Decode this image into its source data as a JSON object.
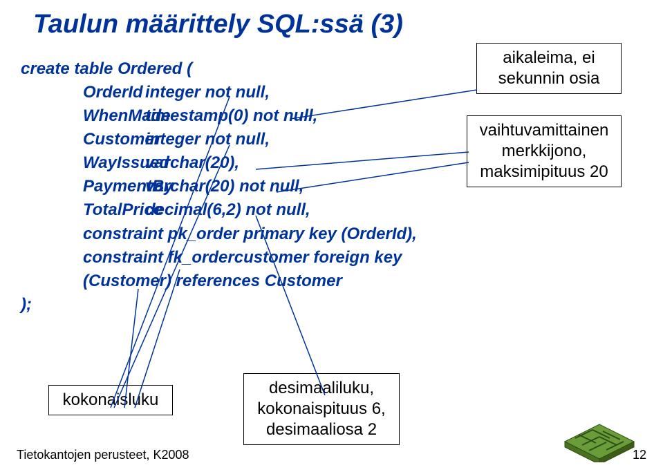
{
  "title": "Taulun määrittely SQL:ssä (3)",
  "code": {
    "line_create": "create table Ordered (",
    "col_OrderId_name": "OrderId",
    "col_OrderId_type": "integer not null,",
    "col_WhenMade_name": "WhenMade",
    "col_WhenMade_type": "timestamp(0) not null,",
    "col_Customer_name": "Customer",
    "col_Customer_type": "integer not null,",
    "col_WayIssued_name": "WayIssued",
    "col_WayIssued_type": "varchar(20),",
    "col_PaymentBy_name": "PaymentBy",
    "col_PaymentBy_type": "varchar(20) not null,",
    "col_TotalPrice_name": "TotalPrice",
    "col_TotalPrice_type": "decimal(6,2) not null,",
    "constraint_pk": "constraint pk_order primary key (OrderId),",
    "constraint_fk": "constraint fk_ordercustomer foreign key",
    "references": "(Customer) references Customer",
    "close": ");"
  },
  "annotations": {
    "aikaleima": "aikaleima, ei sekunnin osia",
    "vaihtuva": "vaihtuvamittainen merkkijono, maksimipituus 20",
    "kokonaisluku": "kokonaisluku",
    "desimaali": "desimaaliluku, kokonaispituus 6, desimaaliosa 2"
  },
  "footer": {
    "left": "Tietokantojen perusteet, K2008",
    "page": "12"
  }
}
